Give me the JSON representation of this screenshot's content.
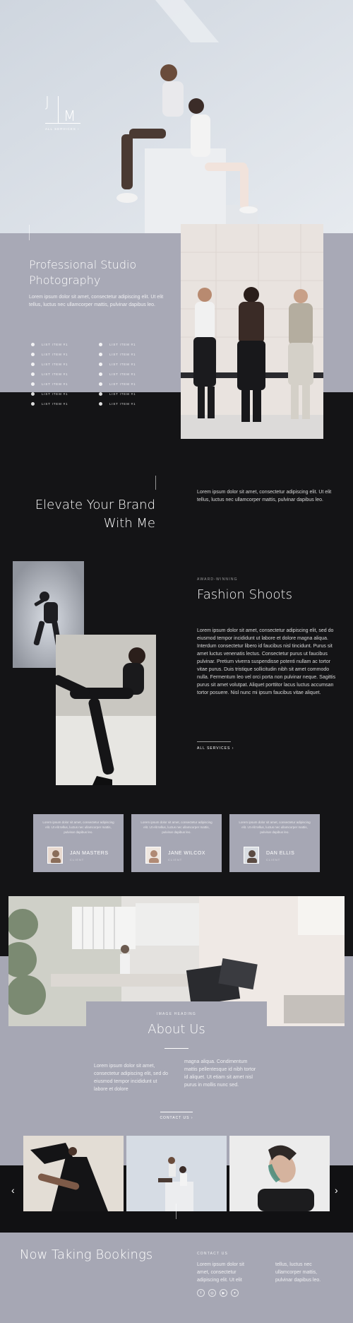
{
  "hero": {
    "logo_j": "J",
    "logo_m": "M",
    "logo_link": "ALL SERVICES",
    "logo_link_icon": "chevron-right-icon"
  },
  "intro": {
    "title_line1": "Professional Studio",
    "title_line2": "Photography",
    "text": "Lorem ipsum dolor sit amet, consectetur adipiscing elit. Ut elit tellus, luctus nec ullamcorper mattis, pulvinar dapibus leo.",
    "list_left": [
      "LIST ITEM #1",
      "LIST ITEM #1",
      "LIST ITEM #1",
      "LIST ITEM #1",
      "LIST ITEM #1",
      "LIST ITEM #1",
      "LIST ITEM #1"
    ],
    "list_right": [
      "LIST ITEM #1",
      "LIST ITEM #1",
      "LIST ITEM #1",
      "LIST ITEM #1",
      "LIST ITEM #1",
      "LIST ITEM #1",
      "LIST ITEM #1"
    ]
  },
  "elevate": {
    "title_line1": "Elevate Your Brand",
    "title_line2": "With Me",
    "text": "Lorem ipsum dolor sit amet, consectetur adipiscing elit. Ut elit tellus, luctus nec ullamcorper mattis, pulvinar dapibus leo."
  },
  "fashion": {
    "eyebrow": "AWARD-WINNING",
    "title": "Fashion Shoots",
    "text": "Lorem ipsum dolor sit amet, consectetur adipiscing elit, sed do eiusmod tempor incididunt ut labore et dolore magna aliqua. Interdum consectetur libero id faucibus nisl tincidunt. Purus sit amet luctus venenatis lectus. Consectetur purus ut faucibus pulvinar. Pretium viverra suspendisse potenti nullam ac tortor vitae purus. Duis tristique sollicitudin nibh sit amet commodo nulla. Fermentum leo vel orci porta non pulvinar neque. Sagittis purus sit amet volutpat. Aliquet porttitor lacus luctus accumsan tortor posuere. Nisl nunc mi ipsum faucibus vitae aliquet.",
    "link": "ALL SERVICES"
  },
  "testimonials": [
    {
      "quote": "Lorem ipsum dolor sit amet, consectetur adipiscing elit. Ut elit tellus, luctus nec ullamcorper mattis, pulvinar dapibus leo.",
      "name": "JAN MASTERS",
      "role": "CLIENT"
    },
    {
      "quote": "Lorem ipsum dolor sit amet, consectetur adipiscing elit. Ut elit tellus, luctus nec ullamcorper mattis, pulvinar dapibus leo.",
      "name": "JANE WILCOX",
      "role": "CLIENT"
    },
    {
      "quote": "Lorem ipsum dolor sit amet, consectetur adipiscing elit. Ut elit tellus, luctus nec ullamcorper mattis, pulvinar dapibus leo.",
      "name": "DAN ELLIS",
      "role": "CLIENT"
    }
  ],
  "about": {
    "eyebrow": "IMAGE HEADING",
    "title": "About Us",
    "col1": "Lorem ipsum dolor sit amet, consectetur adipiscing elit, sed do eiusmod tempor incididunt ut labore et dolore",
    "col2": "magna aliqua. Condimentum mattis pellentesque id nibh tortor id aliquet. Ut etiam sit amet nisl purus in mollis nunc sed.",
    "link": "CONTACT US"
  },
  "gallery": {
    "prev_icon": "chevron-left-icon",
    "next_icon": "chevron-right-icon"
  },
  "bookings": {
    "title": "Now Taking Bookings",
    "eyebrow": "CONTACT US",
    "col1": "Lorem ipsum dolor sit amet, consectetur adipiscing elit. Ut elit",
    "col2": "tellus, luctus nec ullamcorper mattis, pulvinar dapibus leo.",
    "social": [
      "facebook-icon",
      "instagram-icon",
      "youtube-icon",
      "twitter-icon"
    ]
  },
  "colors": {
    "dark": "#141416",
    "slate": "#a6a7b4",
    "hero_bg": "#d7dde5"
  }
}
